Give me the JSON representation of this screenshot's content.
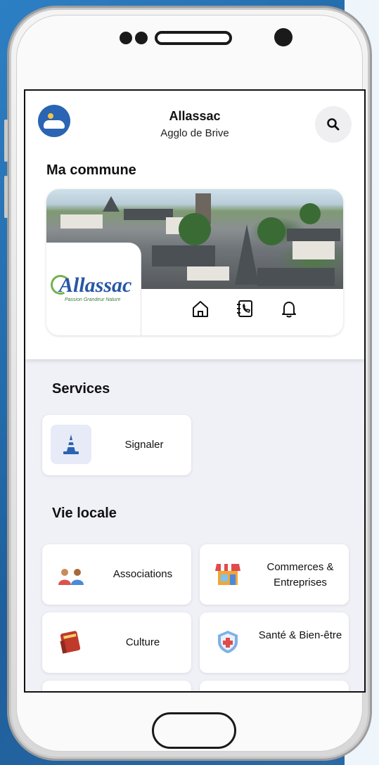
{
  "header": {
    "title": "Allassac",
    "subtitle": "Agglo de Brive"
  },
  "commune": {
    "section_title": "Ma commune",
    "logo_name": "Allassac",
    "logo_tagline": "Passion Grandeur Nature",
    "icons": [
      "home-icon",
      "phone-book-icon",
      "bell-icon"
    ]
  },
  "services": {
    "section_title": "Services",
    "items": [
      {
        "label": "Signaler",
        "icon": "traffic-cone-icon"
      }
    ]
  },
  "vie_locale": {
    "section_title": "Vie locale",
    "items": [
      {
        "label": "Associations",
        "icon": "people-icon"
      },
      {
        "label": "Commerces & Entreprises",
        "icon": "shop-icon"
      },
      {
        "label": "Culture",
        "icon": "book-icon"
      },
      {
        "label": "Santé & Bien-être",
        "icon": "health-shield-icon"
      }
    ]
  },
  "colors": {
    "primary": "#2a64b3",
    "background": "#f0f0f7",
    "frame_bg": "#2d7fc4"
  }
}
